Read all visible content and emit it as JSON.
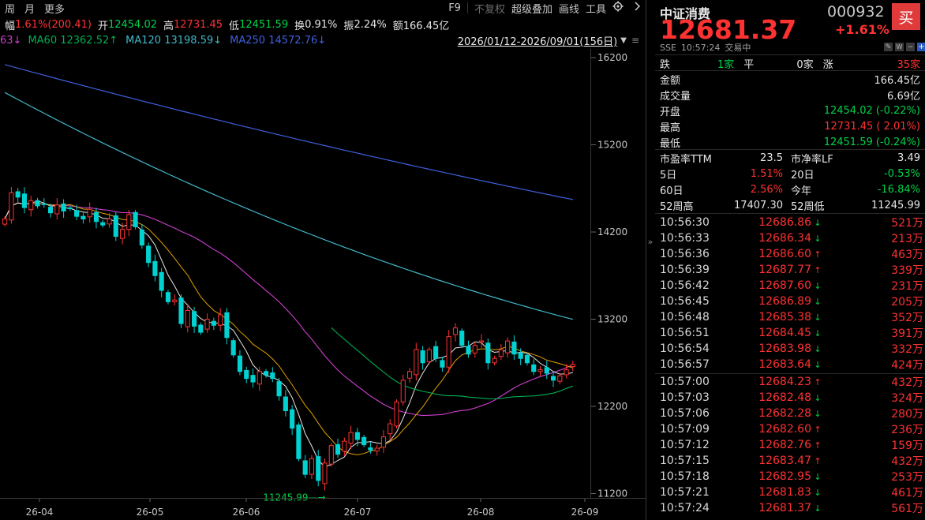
{
  "toolbar": {
    "tabs": [
      "周",
      "月",
      "更多"
    ],
    "tools": [
      {
        "label": "F9",
        "dim": false
      },
      {
        "label": "不复权",
        "dim": true
      },
      {
        "label": "超级叠加",
        "dim": false
      },
      {
        "label": "画线",
        "dim": false
      },
      {
        "label": "工具",
        "dim": false
      }
    ],
    "settings_icon": "gear-icon",
    "more_icon": "chevron-right-icon"
  },
  "quote_row": {
    "change_label": "幅",
    "change_value": "1.61%(200.41)",
    "open_label": "开",
    "open_value": "12454.02",
    "high_label": "高",
    "high_value": "12731.45",
    "low_label": "低",
    "low_value": "12451.59",
    "turnover_label": "换",
    "turnover_value": "0.91%",
    "amplitude_label": "振",
    "amplitude_value": "2.24%",
    "amount_label": "额",
    "amount_value": "166.45亿"
  },
  "ma_row": {
    "ma30_tail": "63↓",
    "ma60": "MA60 12362.52↑",
    "ma120": "MA120 13198.59↓",
    "ma250": "MA250 14572.76↓",
    "date_range": "2026/01/12-2026/09/01(156日)"
  },
  "colors": {
    "up": "#ff3232",
    "down": "#00d2d2",
    "ma5": "#e6e6e6",
    "ma10": "#e0a000",
    "ma20": "#d040d0",
    "ma60": "#00b050",
    "ma120": "#40b8c8",
    "ma250": "#4060e0"
  },
  "chart_data": {
    "type": "candlestick",
    "y_ticks": [
      "16200",
      "15200",
      "14200",
      "13200",
      "12200",
      "11200"
    ],
    "ylim": [
      11150,
      16300
    ],
    "x_ticks": [
      "26-04",
      "26-05",
      "26-06",
      "26-07",
      "26-08",
      "26-09"
    ],
    "low_annotation": "11245.99",
    "close": [
      14350,
      14650,
      14600,
      14480,
      14560,
      14500,
      14520,
      14420,
      14510,
      14440,
      14470,
      14380,
      14350,
      14460,
      14320,
      14280,
      14350,
      14150,
      14230,
      14400,
      14260,
      14050,
      13850,
      13700,
      13530,
      13400,
      13420,
      13150,
      13300,
      13120,
      13050,
      13200,
      13130,
      13250,
      12990,
      12790,
      12600,
      12520,
      12480,
      12600,
      12560,
      12520,
      12320,
      12150,
      11950,
      11600,
      11420,
      11600,
      11350,
      11550,
      11750,
      11650,
      11800,
      11900,
      11820,
      11760,
      11700,
      11720,
      11850,
      12000,
      12250,
      12500,
      12600,
      12850,
      12700,
      12850,
      12750,
      12650,
      13000,
      13100,
      12900,
      12800,
      12900,
      12950,
      12700,
      12750,
      12850,
      12950,
      12800,
      12750,
      12700,
      12600,
      12620,
      12580,
      12500,
      12550,
      12620,
      12681
    ]
  },
  "side": {
    "name": "中证消费",
    "code": "000932",
    "buy_label": "买",
    "price": "12681.37",
    "pct": "+1.61%",
    "exchange": "SSE",
    "time": "10:57:24",
    "status": "交易中",
    "breadth": {
      "down_label": "跌",
      "down_value": "1家",
      "flat_label": "平",
      "flat_value": "0家",
      "up_label": "涨",
      "up_value": "35家"
    },
    "stats": [
      {
        "label": "金额",
        "value": "166.45亿",
        "color": "white"
      },
      {
        "label": "成交量",
        "value": "6.69亿",
        "color": "white"
      },
      {
        "label": "开盘",
        "value": "12454.02 (-0.22%)",
        "color": "green"
      },
      {
        "label": "最高",
        "value": "12731.45 ( 2.01%)",
        "color": "red"
      },
      {
        "label": "最低",
        "value": "12451.59 (-0.24%)",
        "color": "green"
      }
    ],
    "pairs": [
      {
        "l1": "市盈率TTM",
        "v1": "23.5",
        "c1": "white",
        "l2": "市净率LF",
        "v2": "3.49",
        "c2": "white"
      },
      {
        "l1": "5日",
        "v1": "1.51%",
        "c1": "red",
        "l2": "20日",
        "v2": "-0.53%",
        "c2": "green"
      },
      {
        "l1": "60日",
        "v1": "2.56%",
        "c1": "red",
        "l2": "今年",
        "v2": "-16.84%",
        "c2": "green"
      },
      {
        "l1": "52周高",
        "v1": "17407.30",
        "c1": "white",
        "l2": "52周低",
        "v2": "11245.99",
        "c2": "white"
      }
    ],
    "ticks": [
      {
        "time": "10:56:30",
        "price": "12686.86",
        "dir": "down",
        "vol": "521万"
      },
      {
        "time": "10:56:33",
        "price": "12686.34",
        "dir": "down",
        "vol": "213万"
      },
      {
        "time": "10:56:36",
        "price": "12686.60",
        "dir": "up",
        "vol": "463万"
      },
      {
        "time": "10:56:39",
        "price": "12687.77",
        "dir": "up",
        "vol": "339万"
      },
      {
        "time": "10:56:42",
        "price": "12687.60",
        "dir": "down",
        "vol": "231万"
      },
      {
        "time": "10:56:45",
        "price": "12686.89",
        "dir": "down",
        "vol": "205万"
      },
      {
        "time": "10:56:48",
        "price": "12685.38",
        "dir": "down",
        "vol": "352万"
      },
      {
        "time": "10:56:51",
        "price": "12684.45",
        "dir": "down",
        "vol": "391万"
      },
      {
        "time": "10:56:54",
        "price": "12683.98",
        "dir": "down",
        "vol": "332万"
      },
      {
        "time": "10:56:57",
        "price": "12683.64",
        "dir": "down",
        "vol": "424万"
      },
      {
        "time": "10:57:00",
        "price": "12684.23",
        "dir": "up",
        "vol": "432万"
      },
      {
        "time": "10:57:03",
        "price": "12682.48",
        "dir": "down",
        "vol": "324万"
      },
      {
        "time": "10:57:06",
        "price": "12682.28",
        "dir": "down",
        "vol": "280万"
      },
      {
        "time": "10:57:09",
        "price": "12682.60",
        "dir": "up",
        "vol": "236万"
      },
      {
        "time": "10:57:12",
        "price": "12682.76",
        "dir": "up",
        "vol": "159万"
      },
      {
        "time": "10:57:15",
        "price": "12683.47",
        "dir": "up",
        "vol": "432万"
      },
      {
        "time": "10:57:18",
        "price": "12682.95",
        "dir": "down",
        "vol": "253万"
      },
      {
        "time": "10:57:21",
        "price": "12681.83",
        "dir": "down",
        "vol": "461万"
      },
      {
        "time": "10:57:24",
        "price": "12681.37",
        "dir": "down",
        "vol": "561万"
      }
    ]
  }
}
